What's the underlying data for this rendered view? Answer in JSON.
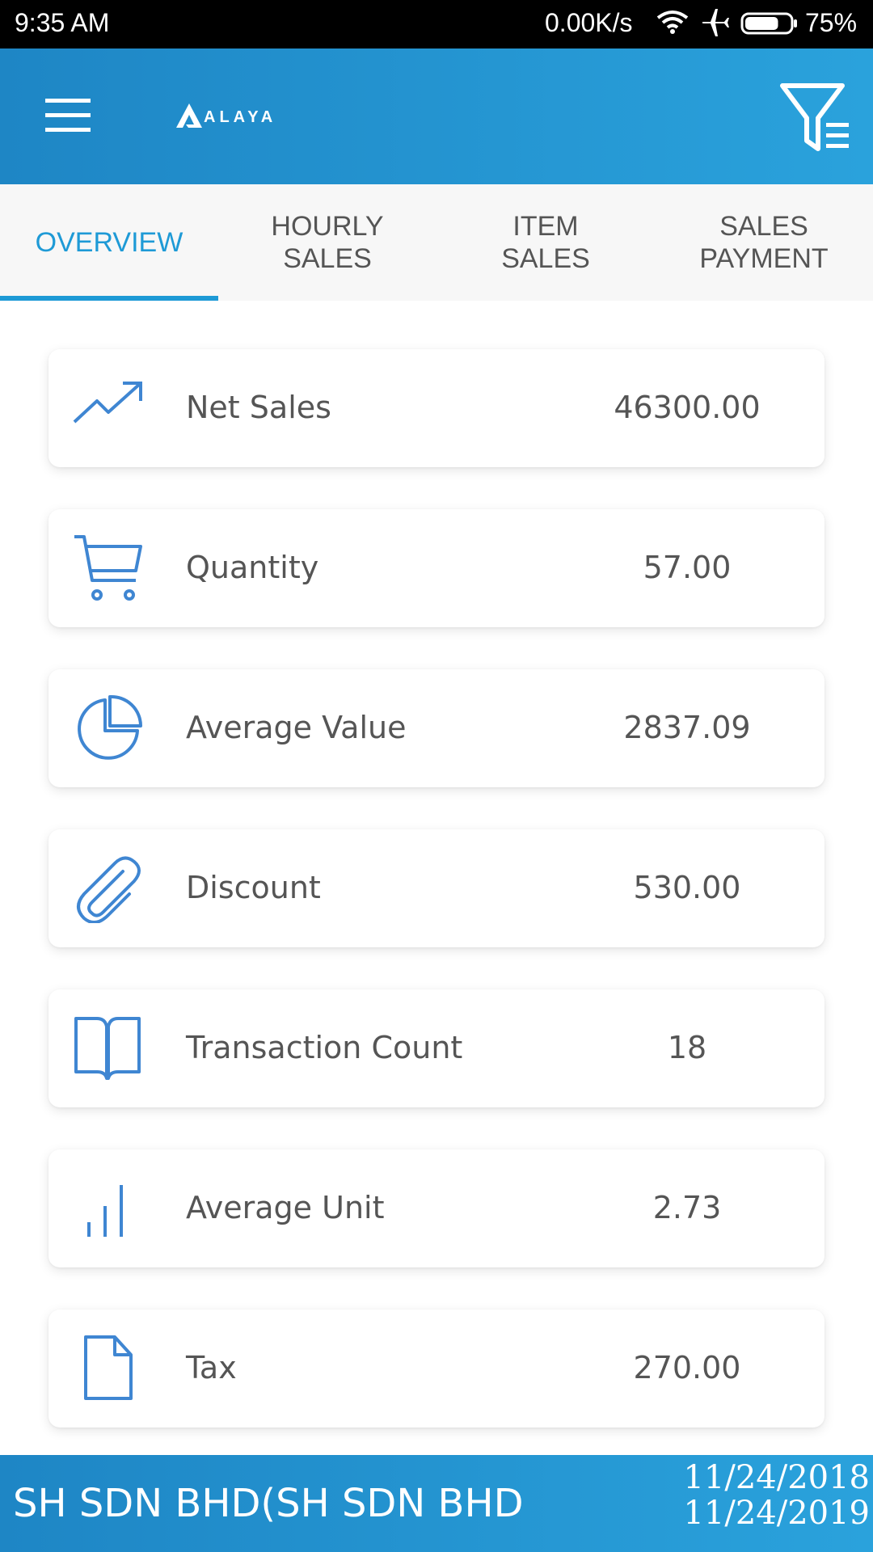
{
  "status_bar": {
    "time": "9:35 AM",
    "network_speed": "0.00K/s",
    "battery_percent": "75%",
    "battery_level": 0.75
  },
  "app_bar": {
    "logo_text": "ALAYA",
    "menu_icon": "hamburger-menu-icon",
    "filter_icon": "filter-list-icon"
  },
  "tabs": [
    {
      "label": "OVERVIEW",
      "active": true
    },
    {
      "label": "HOURLY SALES",
      "active": false
    },
    {
      "label": "ITEM SALES",
      "active": false
    },
    {
      "label": "SALES PAYMENT",
      "active": false
    }
  ],
  "metrics": [
    {
      "label": "Net Sales",
      "value": "46300.00",
      "icon": "trending-up-icon"
    },
    {
      "label": "Quantity",
      "value": "57.00",
      "icon": "cart-icon"
    },
    {
      "label": "Average Value",
      "value": "2837.09",
      "icon": "pie-chart-icon"
    },
    {
      "label": "Discount",
      "value": "530.00",
      "icon": "paperclip-icon"
    },
    {
      "label": "Transaction Count",
      "value": "18",
      "icon": "open-book-icon"
    },
    {
      "label": "Average Unit",
      "value": "2.73",
      "icon": "bar-chart-icon"
    },
    {
      "label": "Tax",
      "value": "270.00",
      "icon": "document-icon"
    }
  ],
  "footer": {
    "store_name": "SH SDN BHD(SH SDN BHD",
    "date_from": "11/24/2018",
    "date_to": "11/24/2019"
  },
  "colors": {
    "accent": "#1e9ad6",
    "app_bar": "#1e86c5",
    "icon_blue": "#3f86d2",
    "text": "#555555"
  }
}
